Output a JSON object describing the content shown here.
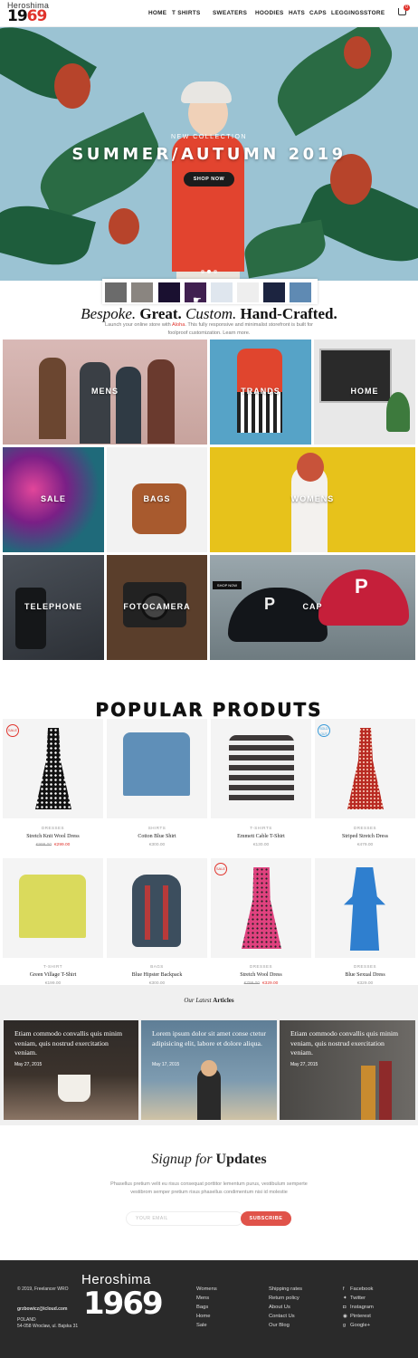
{
  "header": {
    "logo_text": "Heroshima",
    "logo_number_a": "19",
    "logo_number_b": "69",
    "nav": [
      "HOME",
      "T SHIRTS",
      "SWEATERS",
      "HOODIES",
      "HATS",
      "CAPS",
      "LEGGINGS",
      "STORE"
    ],
    "cart_count": "0"
  },
  "hero": {
    "kicker": "NEW COLLECTION",
    "title": "SUMMER/AUTUMN 2019",
    "button": "SHOP NOW",
    "slide_count": 3,
    "active_slide": 1
  },
  "tagline": {
    "title_a": "Bespoke.",
    "title_b": "Great.",
    "title_c": "Custom.",
    "title_d": "Hand-Crafted.",
    "text_a": "Launch your online store with",
    "text_brand": "Aloha",
    "text_b": ". This fully responsive and minimalist storefront is built for foolproof customization. Learn more."
  },
  "categories": [
    "MENS",
    "TRANDS",
    "HOME",
    "SALE",
    "BAGS",
    "WOMENS",
    "TELEPHONE",
    "FOTOCAMERA",
    "CAP"
  ],
  "shop_now_small": "SHOP NOW",
  "popular": {
    "title": "POPULAR PRODUTS",
    "products": [
      {
        "category": "DRESSES",
        "name": "Stretch Knit Wool Dress",
        "old_price": "€999.00",
        "price": "€299.00",
        "badge": "SALE"
      },
      {
        "category": "SHIRTS",
        "name": "Cotton Blue Shirt",
        "old_price": "",
        "price": "€300.00",
        "badge": ""
      },
      {
        "category": "T-SHIRTS",
        "name": "Emmett Cable T-Shirt",
        "old_price": "",
        "price": "€130.00",
        "badge": ""
      },
      {
        "category": "DRESSES",
        "name": "Striped Stretch Dress",
        "old_price": "",
        "price": "€479.00",
        "badge": "SOLD OUT"
      },
      {
        "category": "T-SHIRT",
        "name": "Green Village T-Shirt",
        "old_price": "",
        "price": "€199.00",
        "badge": ""
      },
      {
        "category": "BAGS",
        "name": "Blue Hipster Backpack",
        "old_price": "",
        "price": "€300.00",
        "badge": ""
      },
      {
        "category": "DRESSES",
        "name": "Stretch Wool Dress",
        "old_price": "€799.00",
        "price": "€329.00",
        "badge": "SALE"
      },
      {
        "category": "DRESSES",
        "name": "Blue Sexual Dress",
        "old_price": "",
        "price": "€329.00",
        "badge": ""
      }
    ]
  },
  "articles": {
    "heading_a": "Our Latest",
    "heading_b": "Articles",
    "items": [
      {
        "title": "Etiam commodo convallis quis minim veniam, quis nostrud exercitation veniam.",
        "date": "May 27, 2015"
      },
      {
        "title": "Lorem ipsum dolor sit amet conse ctetur adipisicing elit, labore et dolore aliqua.",
        "date": "May 17, 2015"
      },
      {
        "title": "Etiam commodo convallis quis minim veniam, quis nostrud exercitation veniam.",
        "date": "May 27, 2015"
      }
    ]
  },
  "signup": {
    "title_a": "Signup",
    "title_b": "for",
    "title_c": "Updates",
    "text": "Phasellus pretium velit eu risus consequat porttitor lementum purus, vestibulum semperte vestibrom semper pretium risus phasellus condimentum nisi id molestie",
    "email_placeholder": "YOUR EMAIL",
    "button": "SUBSCRIBE"
  },
  "footer": {
    "copyright": "© 2019, Freelancer WRO",
    "email": "grzbowicz@icloud.com",
    "address_1": "POLAND",
    "address_2": "54-058 Wroclaw, ul. Bajska 31",
    "logo_text": "Heroshima",
    "logo_number": "1969",
    "col1": [
      "Womens",
      "Mens",
      "Bags",
      "Home",
      "Sale"
    ],
    "col2": [
      "Shipping rates",
      "Return policy",
      "About Us",
      "Contact Us",
      "Our Blog"
    ],
    "social": [
      "Facebook",
      "Twitter",
      "Instagram",
      "Pinterest",
      "Google+"
    ]
  },
  "colors": {
    "accent": "#e0332c",
    "footer_bg": "#2a2a2a",
    "hero_bg": "#9bc3d3"
  }
}
